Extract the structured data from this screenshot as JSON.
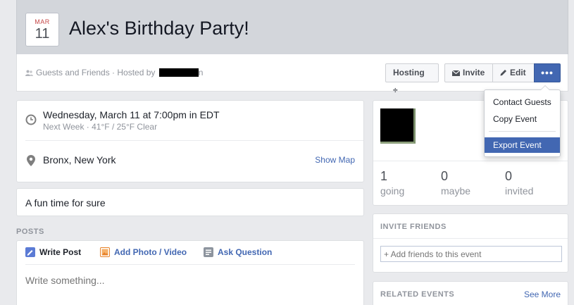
{
  "header": {
    "date_month": "MAR",
    "date_day": "11",
    "title": "Alex's Birthday Party!"
  },
  "subbar": {
    "info_text": "Guests and Friends · Hosted by",
    "host_name_trail": "n",
    "hosting_label": "Hosting ÷",
    "invite_label": "Invite",
    "edit_label": "Edit",
    "more_label": "•••"
  },
  "dropdown": {
    "items": [
      "Contact Guests",
      "Copy Event",
      "Export Event"
    ]
  },
  "details": {
    "time": "Wednesday, March 11 at 7:00pm in EDT",
    "weather": "Next Week · 41°F / 25°F Clear",
    "location": "Bronx, New York",
    "show_map": "Show Map"
  },
  "description": "A fun time for sure",
  "posts": {
    "section_label": "POSTS",
    "tabs": [
      "Write Post",
      "Add Photo / Video",
      "Ask Question"
    ],
    "placeholder": "Write something..."
  },
  "rsvp": {
    "going_count": "1",
    "going_label": "going",
    "maybe_count": "0",
    "maybe_label": "maybe",
    "invited_count": "0",
    "invited_label": "invited"
  },
  "invite_friends": {
    "title": "INVITE FRIENDS",
    "placeholder": "+ Add friends to this event"
  },
  "related_events": {
    "title": "RELATED EVENTS",
    "see_more": "See More"
  },
  "colors": {
    "accent": "#4267b2",
    "header_bg": "#d3d6db",
    "page_bg": "#e9eaed"
  }
}
